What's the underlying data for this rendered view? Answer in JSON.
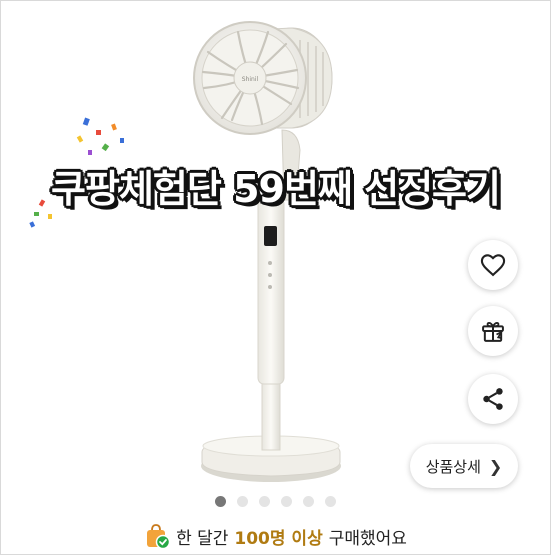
{
  "headline": "쿠팡체험단 59번째 선정후기",
  "product_image": {
    "brand_text": "Shinil"
  },
  "actions": {
    "like": {
      "icon": "heart-icon"
    },
    "gift": {
      "icon": "gift-icon"
    },
    "share": {
      "icon": "share-icon"
    },
    "details": {
      "label": "상품상세",
      "icon": "chevron-right-icon"
    }
  },
  "carousel": {
    "total": 6,
    "active_index": 0
  },
  "purchase_notice": {
    "prefix": "한 달간",
    "highlight": "100명 이상",
    "suffix": "구매했어요",
    "icon": "shopping-bag-check-icon",
    "highlight_color": "#b07b12"
  }
}
